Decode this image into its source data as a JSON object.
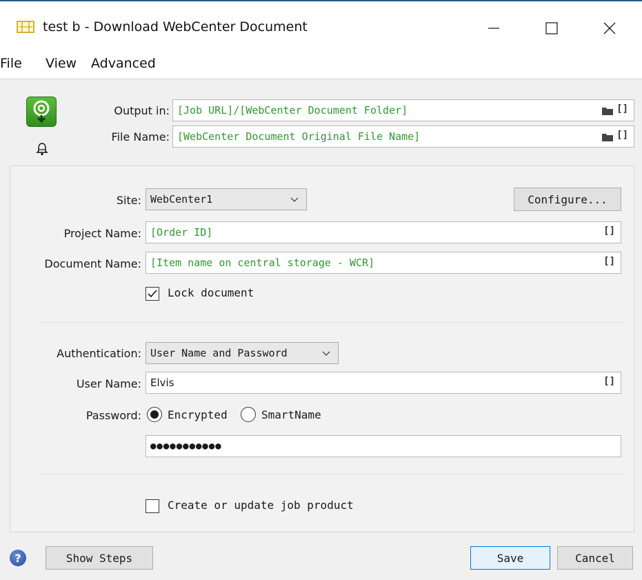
{
  "window": {
    "title": "test b - Download WebCenter Document",
    "controls": {
      "minimize": "minimize-icon",
      "maximize": "maximize-icon",
      "close": "close-icon"
    }
  },
  "menu": [
    "File",
    "View",
    "Advanced"
  ],
  "header": {
    "output_label": "Output in:",
    "output_value": "[Job URL]/[WebCenter Document Folder]",
    "filename_label": "File Name:",
    "filename_value": "[WebCenter Document Original File Name]"
  },
  "form": {
    "site_label": "Site:",
    "site_value": "WebCenter1",
    "configure_label": "Configure...",
    "project_label": "Project Name:",
    "project_value": "[Order ID]",
    "document_label": "Document Name:",
    "document_value": "[Item name on central storage - WCR]",
    "lock_label": "Lock document",
    "lock_checked": true,
    "auth_label": "Authentication:",
    "auth_value": "User Name and Password",
    "username_label": "User Name:",
    "username_value": "Elvis",
    "password_label": "Password:",
    "password_mode_encrypted": "Encrypted",
    "password_mode_smartname": "SmartName",
    "password_mode_selected": "Encrypted",
    "password_value": "●●●●●●●●●●●",
    "create_product_label": "Create or update job product",
    "create_product_checked": false
  },
  "footer": {
    "show_steps_label": "Show Steps",
    "save_label": "Save",
    "cancel_label": "Cancel"
  },
  "colors": {
    "smartname_text": "#2e9a2e",
    "title_border": "#2b5a87",
    "primary_border": "#0078d7"
  }
}
